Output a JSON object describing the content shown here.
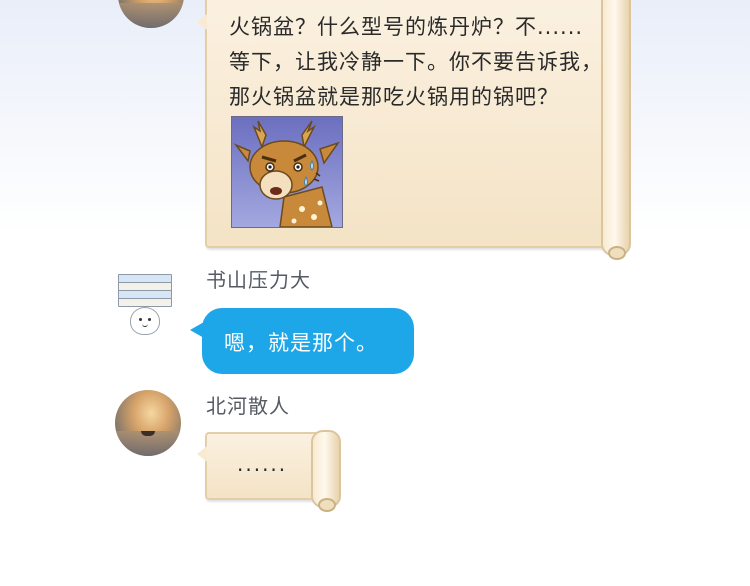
{
  "messages": [
    {
      "lines": [
        "火锅盆？什么型号的炼丹炉？不......",
        "等下，让我冷静一下。你不要告诉我，",
        "那火锅盆就是那吃火锅用的锅吧？"
      ],
      "sticker": "deer-sweating-sticker"
    },
    {
      "username": "书山压力大",
      "text": "嗯，就是那个。"
    },
    {
      "username": "北河散人",
      "text": "......"
    }
  ],
  "colors": {
    "blue_bubble": "#1ea7e8",
    "parchment": "#f4e3c5",
    "username_gray": "#555a63"
  }
}
